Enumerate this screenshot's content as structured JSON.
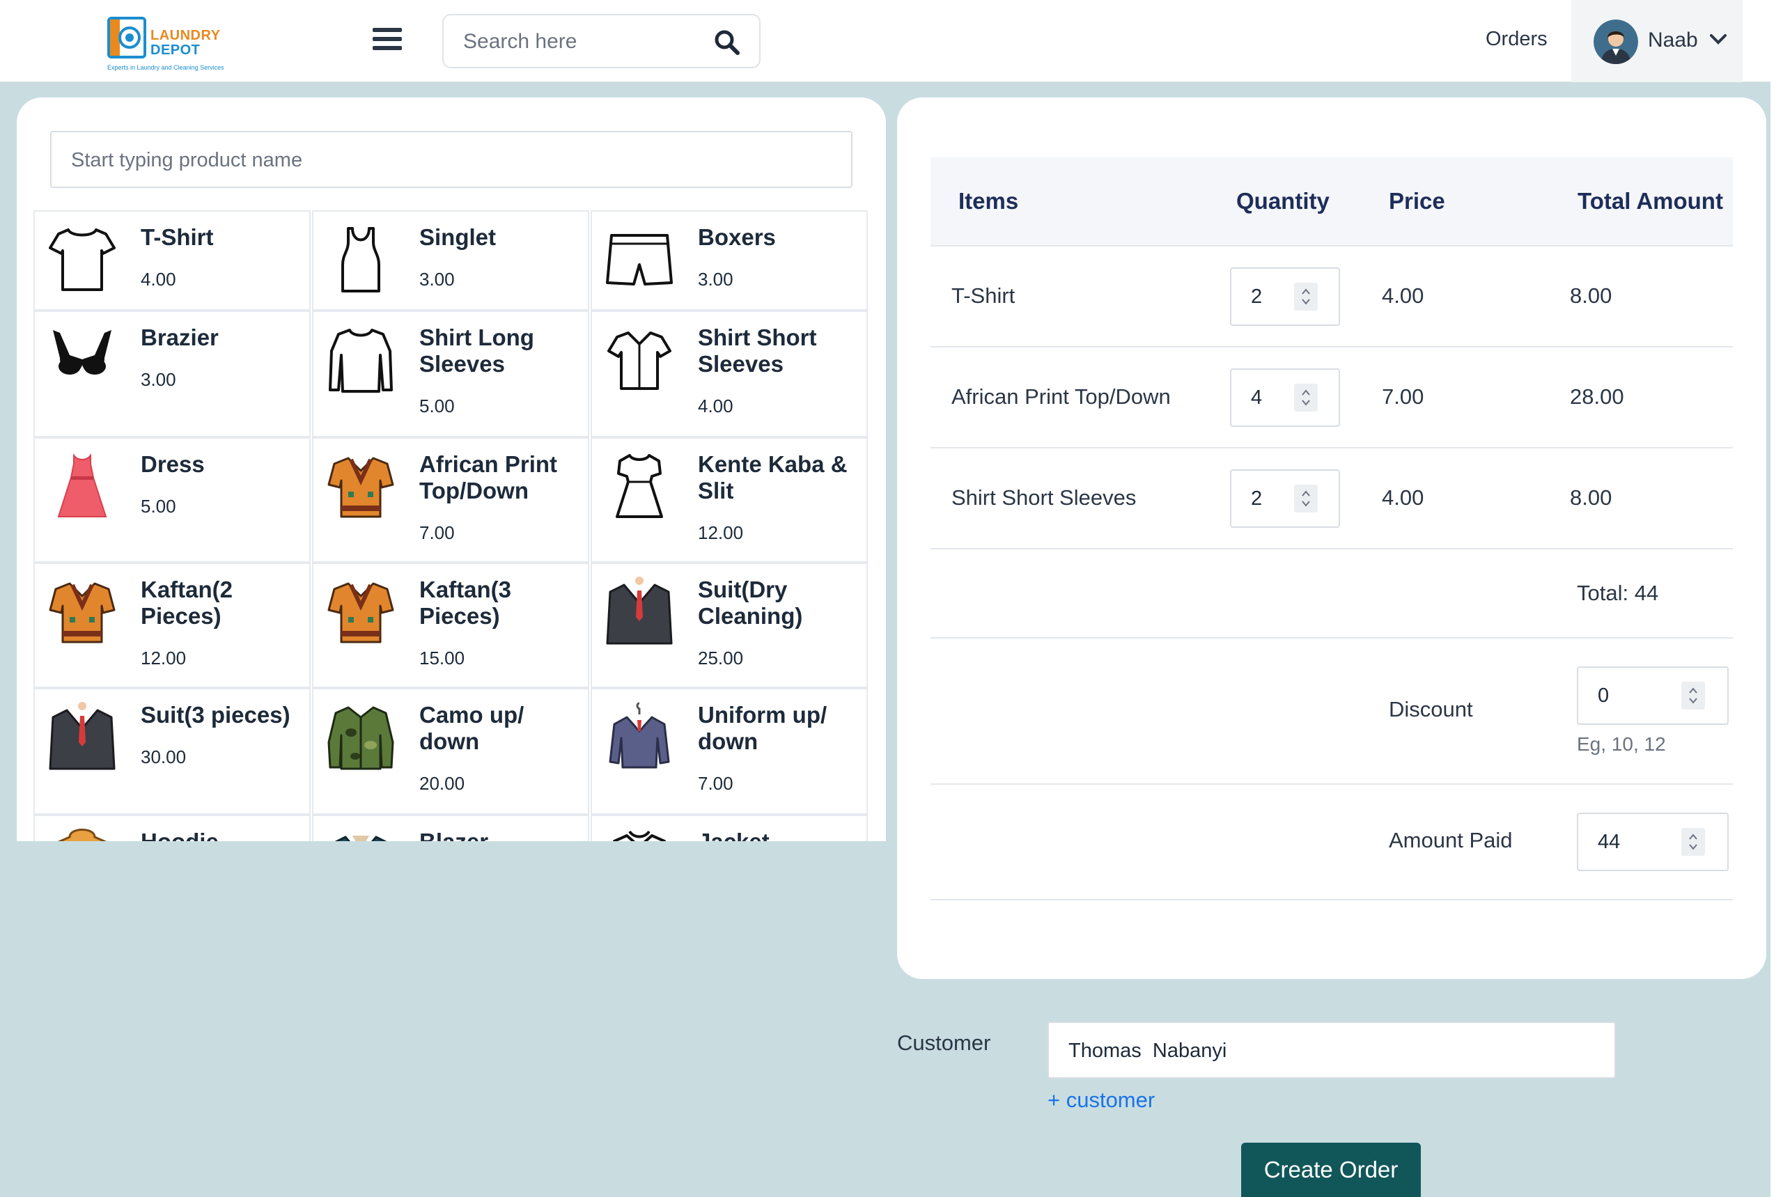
{
  "header": {
    "logo": {
      "line1": "LAUNDRY",
      "line2": "DEPOT",
      "tagline": "Experts in Laundry and Cleaning Services"
    },
    "search_placeholder": "Search here",
    "orders_label": "Orders",
    "user_name": "Naab"
  },
  "products": {
    "search_placeholder": "Start typing product name",
    "items": [
      {
        "name": "T-Shirt",
        "price": "4.00",
        "icon": "tshirt-icon"
      },
      {
        "name": "Singlet",
        "price": "3.00",
        "icon": "singlet-icon"
      },
      {
        "name": "Boxers",
        "price": "3.00",
        "icon": "boxers-icon"
      },
      {
        "name": "Brazier",
        "price": "3.00",
        "icon": "brazier-icon"
      },
      {
        "name": "Shirt Long Sleeves",
        "price": "5.00",
        "icon": "long-sleeve-shirt-icon"
      },
      {
        "name": "Shirt Short Sleeves",
        "price": "4.00",
        "icon": "short-sleeve-shirt-icon"
      },
      {
        "name": "Dress",
        "price": "5.00",
        "icon": "dress-icon"
      },
      {
        "name": "African Print Top/Down",
        "price": "7.00",
        "icon": "african-print-icon"
      },
      {
        "name": "Kente Kaba & Slit",
        "price": "12.00",
        "icon": "kaba-dress-icon"
      },
      {
        "name": "Kaftan(2 Pieces)",
        "price": "12.00",
        "icon": "kaftan-icon"
      },
      {
        "name": "Kaftan(3 Pieces)",
        "price": "15.00",
        "icon": "kaftan-icon"
      },
      {
        "name": "Suit(Dry Cleaning)",
        "price": "25.00",
        "icon": "suit-icon"
      },
      {
        "name": "Suit(3 pieces)",
        "price": "30.00",
        "icon": "suit-icon"
      },
      {
        "name": "Camo up/ down",
        "price": "20.00",
        "icon": "camo-jacket-icon"
      },
      {
        "name": "Uniform up/ down",
        "price": "7.00",
        "icon": "uniform-icon"
      },
      {
        "name": "Hoodie",
        "price": "",
        "icon": "hoodie-icon"
      },
      {
        "name": "Blazer",
        "price": "",
        "icon": "blazer-icon"
      },
      {
        "name": "Jacket",
        "price": "",
        "icon": "jacket-icon"
      }
    ]
  },
  "order": {
    "headers": {
      "items": "Items",
      "quantity": "Quantity",
      "price": "Price",
      "total": "Total Amount"
    },
    "rows": [
      {
        "item": "T-Shirt",
        "quantity": "2",
        "price": "4.00",
        "total": "8.00"
      },
      {
        "item": "African Print Top/Down",
        "quantity": "4",
        "price": "7.00",
        "total": "28.00"
      },
      {
        "item": "Shirt Short Sleeves",
        "quantity": "2",
        "price": "4.00",
        "total": "8.00"
      }
    ],
    "total_text": "Total: 44",
    "discount_label": "Discount",
    "discount_value": "0",
    "discount_hint": "Eg, 10, 12",
    "amount_paid_label": "Amount Paid",
    "amount_paid_value": "44"
  },
  "customer": {
    "label": "Customer",
    "value": "Thomas  Nabanyi",
    "add_label": "+ customer"
  },
  "actions": {
    "create_order_label": "Create Order"
  },
  "colors": {
    "page_bg": "#c9dde1",
    "primary_button": "#11575a",
    "link": "#1a73e8",
    "heading": "#1e2d5a"
  }
}
